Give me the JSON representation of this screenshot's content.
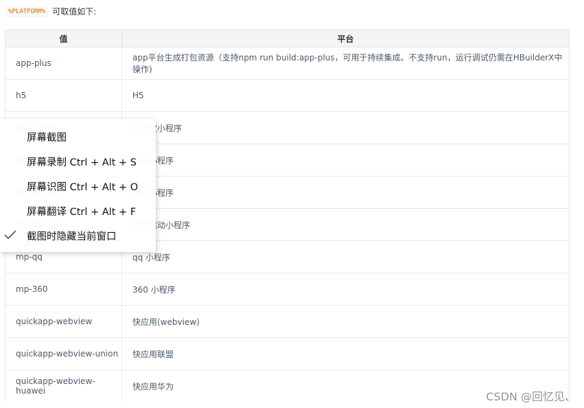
{
  "intro": {
    "code": "%PLATFORM%",
    "text": "可取值如下:"
  },
  "table": {
    "headers": [
      "值",
      "平台"
    ],
    "rows": [
      {
        "value": "app-plus",
        "platform": "app平台生成打包资源（支持npm run build:app-plus，可用于持续集成。不支持run，运行调试仍需在HBuilderX中操作)"
      },
      {
        "value": "h5",
        "platform": "H5"
      },
      {
        "value": "mp-alipay",
        "platform": "支付宝小程序"
      },
      {
        "value": "mp-baidu",
        "platform": "百度小程序"
      },
      {
        "value": "mp-weixin",
        "platform": "微信小程序"
      },
      {
        "value": "mp-toutiao",
        "platform": "字节跳动小程序"
      },
      {
        "value": "mp-qq",
        "platform": "qq 小程序"
      },
      {
        "value": "mp-360",
        "platform": "360 小程序"
      },
      {
        "value": "quickapp-webview",
        "platform": "快应用(webview)"
      },
      {
        "value": "quickapp-webview-union",
        "platform": "快应用联盟"
      },
      {
        "value": "quickapp-webview-huawei",
        "platform": "快应用华为"
      }
    ]
  },
  "context_menu": {
    "items": [
      {
        "label": "屏幕截图",
        "checked": false
      },
      {
        "label": "屏幕录制 Ctrl + Alt + S",
        "checked": false
      },
      {
        "label": "屏幕识图 Ctrl + Alt + O",
        "checked": false
      },
      {
        "label": "屏幕翻译 Ctrl + Alt + F",
        "checked": false
      },
      {
        "label": "截图时隐藏当前窗口",
        "checked": true
      }
    ]
  },
  "watermark": "CSDN @回忆见、"
}
